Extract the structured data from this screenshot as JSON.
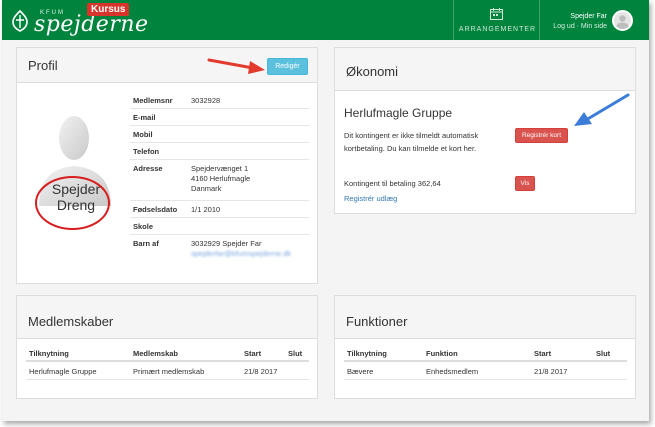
{
  "header": {
    "logo_prefix": "KFUM",
    "logo_text": "spejderne",
    "badge": "Kursus",
    "events_label": "ARRANGEMENTER",
    "user_name": "Spejder Far",
    "user_links": "Log ud · Min side",
    "colors": {
      "brand": "#00843d",
      "badge": "#d9342b"
    }
  },
  "profile": {
    "title": "Profil",
    "edit_label": "Redigér",
    "avatar_caption_line1": "Spejder",
    "avatar_caption_line2": "Dreng",
    "fields": [
      {
        "label": "Medlemsnr",
        "value": "3032928"
      },
      {
        "label": "E-mail",
        "value": ""
      },
      {
        "label": "Mobil",
        "value": ""
      },
      {
        "label": "Telefon",
        "value": ""
      },
      {
        "label": "Adresse",
        "value_lines": [
          "Spejdervænget 1",
          "4160 Herlufmagle",
          "Danmark"
        ]
      },
      {
        "label": "Fødselsdato",
        "value": "1/1 2010"
      },
      {
        "label": "Skole",
        "value": ""
      },
      {
        "label": "Barn af",
        "value": "3032929 Spejder Far",
        "value_secondary": "spejderfar@kfumspejderne.dk"
      }
    ]
  },
  "economy": {
    "title": "Økonomi",
    "group": "Herlufmagle Gruppe",
    "kontingent_text": "Dit kontingent er ikke tilmeldt automatisk kortbetaling. Du kan tilmelde et kort her.",
    "register_card_label": "Registrér kort",
    "payment_text": "Kontingent til betaling 362,64",
    "show_label": "Vis",
    "register_expense_label": "Registrér udlæg"
  },
  "memberships": {
    "title": "Medlemskaber",
    "columns": [
      "Tilknytning",
      "Medlemskab",
      "Start",
      "Slut"
    ],
    "rows": [
      [
        "Herlufmagle Gruppe",
        "Primært medlemskab",
        "21/8 2017",
        ""
      ]
    ]
  },
  "functions": {
    "title": "Funktioner",
    "columns": [
      "Tilknytning",
      "Funktion",
      "Start",
      "Slut"
    ],
    "rows": [
      [
        "Bævere",
        "Enhedsmedlem",
        "21/8 2017",
        ""
      ]
    ]
  }
}
